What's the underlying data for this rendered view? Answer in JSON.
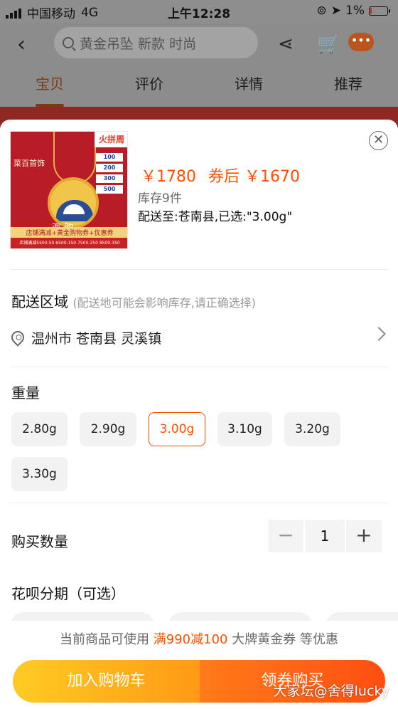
{
  "status_bar": {
    "carrier": "中国移动",
    "network": "4G",
    "time": "上午12:28",
    "battery": "1%"
  },
  "header": {
    "search_placeholder": "黄金吊坠 新款 时尚",
    "tabs": [
      {
        "label": "宝贝",
        "active": true
      },
      {
        "label": "评价",
        "active": false
      },
      {
        "label": "详情",
        "active": false
      },
      {
        "label": "推荐",
        "active": false
      }
    ]
  },
  "product": {
    "price": "￥1780",
    "coupon_price": "券后 ￥1670",
    "stock": "库存9件",
    "shipping": "配送至:苍南县,已选:\"3.00g\"",
    "image_text": {
      "brand": "菜百首饰",
      "stamp": "火拼周",
      "coupons": [
        "100",
        "200",
        "300",
        "500"
      ],
      "banner_top": "店铺满减+黄金购物券+优惠券",
      "banner_bottom": "店铺满减5500-50 6500-150 7500-250 8500-350",
      "name_partial": "海 韵 …"
    }
  },
  "delivery": {
    "title": "配送区域",
    "hint": "(配送地可能会影响库存,请正确选择)",
    "address": "温州市 苍南县 灵溪镇"
  },
  "weight": {
    "title": "重量",
    "options": [
      "2.80g",
      "2.90g",
      "3.00g",
      "3.10g",
      "3.20g",
      "3.30g"
    ],
    "selected": "3.00g"
  },
  "quantity": {
    "label": "购买数量",
    "value": "1",
    "minus": "−",
    "plus": "+"
  },
  "installment": {
    "title": "花呗分期（可选）"
  },
  "promo": {
    "prefix": "当前商品可使用",
    "highlight": "满990减100",
    "suffix": "大牌黄金券 等优惠"
  },
  "actions": {
    "cart": "加入购物车",
    "buy": "领券购买"
  },
  "watermark": "大家坛@舍得lucky",
  "colors": {
    "accent": "#ff5000",
    "cart_gradient": "#ffcb24",
    "buy_gradient": "#ff4e12"
  }
}
